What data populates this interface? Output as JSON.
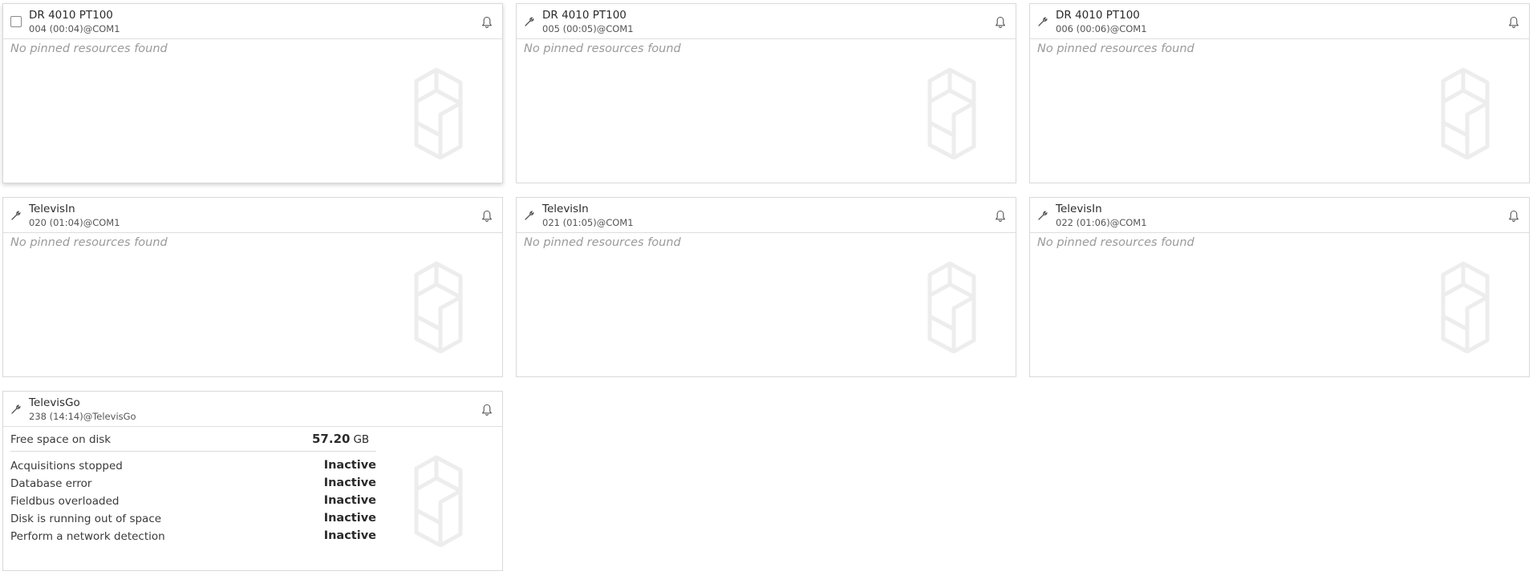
{
  "cards": [
    {
      "title": "DR 4010 PT100",
      "subtitle": "004 (00:04)@COM1",
      "lead": "checkbox",
      "message": "No pinned resources found"
    },
    {
      "title": "DR 4010 PT100",
      "subtitle": "005 (00:05)@COM1",
      "lead": "wrench",
      "message": "No pinned resources found"
    },
    {
      "title": "DR 4010 PT100",
      "subtitle": "006 (00:06)@COM1",
      "lead": "wrench",
      "message": "No pinned resources found"
    },
    {
      "title": "TelevisIn",
      "subtitle": "020 (01:04)@COM1",
      "lead": "wrench",
      "message": "No pinned resources found"
    },
    {
      "title": "TelevisIn",
      "subtitle": "021 (01:05)@COM1",
      "lead": "wrench",
      "message": "No pinned resources found"
    },
    {
      "title": "TelevisIn",
      "subtitle": "022 (01:06)@COM1",
      "lead": "wrench",
      "message": "No pinned resources found"
    },
    {
      "title": "TelevisGo",
      "subtitle": "238 (14:14)@TelevisGo",
      "lead": "wrench",
      "disk": {
        "label": "Free space on disk",
        "value": "57.20",
        "unit": "GB"
      },
      "statuses": [
        {
          "label": "Acquisitions stopped",
          "value": "Inactive"
        },
        {
          "label": "Database error",
          "value": "Inactive"
        },
        {
          "label": "Fieldbus overloaded",
          "value": "Inactive"
        },
        {
          "label": "Disk is running out of space",
          "value": "Inactive"
        },
        {
          "label": "Perform a network detection",
          "value": "Inactive"
        }
      ]
    }
  ],
  "icons": {
    "wrench": "wrench-icon",
    "bell": "bell-icon",
    "watermark": "device-watermark-icon",
    "checkbox": "checkbox"
  },
  "colors": {
    "border": "#d9d9d9",
    "muted_text": "#9a9a9a",
    "icon": "#555555",
    "watermark": "#eeeeee"
  }
}
